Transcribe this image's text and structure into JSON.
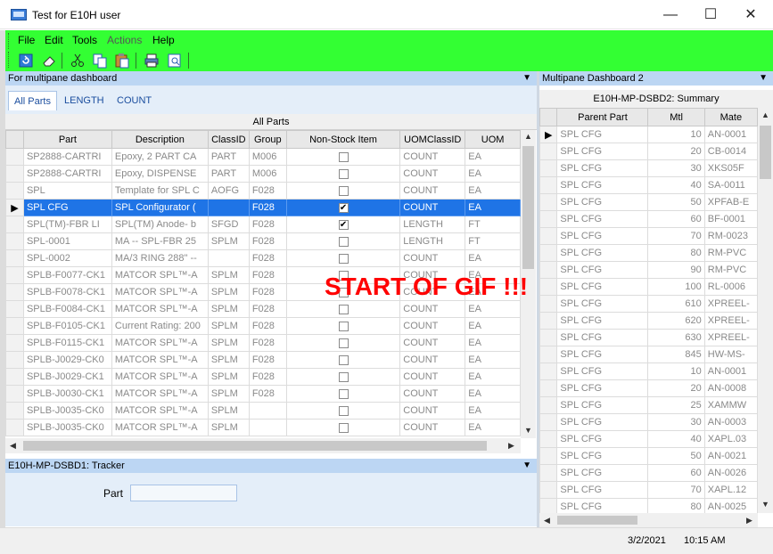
{
  "window": {
    "title": "Test for E10H user"
  },
  "menu": [
    "File",
    "Edit",
    "Tools",
    "Actions",
    "Help"
  ],
  "toolbar_icons": [
    "refresh-icon",
    "eraser-icon",
    "cut-icon",
    "copy-icon",
    "paste-icon",
    "print-icon",
    "print-preview-icon"
  ],
  "left_pane": {
    "header": "For multipane dashboard",
    "tabs": [
      "All Parts",
      "LENGTH",
      "COUNT"
    ],
    "grid_title": "All Parts",
    "columns": [
      "Part",
      "Description",
      "ClassID",
      "Group",
      "Non-Stock Item",
      "UOMClassID",
      "UOM"
    ],
    "rows": [
      {
        "part": "SP2888-CARTRI",
        "desc": "Epoxy, 2 PART CA",
        "classid": "PART",
        "group": "M006",
        "nonstock": false,
        "uomclass": "COUNT",
        "uom": "EA"
      },
      {
        "part": "SP2888-CARTRI",
        "desc": "Epoxy, DISPENSE",
        "classid": "PART",
        "group": "M006",
        "nonstock": false,
        "uomclass": "COUNT",
        "uom": "EA"
      },
      {
        "part": "SPL",
        "desc": "Template for SPL C",
        "classid": "AOFG",
        "group": "F028",
        "nonstock": false,
        "uomclass": "COUNT",
        "uom": "EA"
      },
      {
        "part": "SPL CFG",
        "desc": "SPL Configurator (",
        "classid": "",
        "group": "F028",
        "nonstock": true,
        "uomclass": "COUNT",
        "uom": "EA",
        "selected": true
      },
      {
        "part": "SPL(TM)-FBR LI",
        "desc": "SPL(TM) Anode- b",
        "classid": "SFGD",
        "group": "F028",
        "nonstock": true,
        "uomclass": "LENGTH",
        "uom": "FT"
      },
      {
        "part": "SPL-0001",
        "desc": "MA  -- SPL-FBR 25",
        "classid": "SPLM",
        "group": "F028",
        "nonstock": false,
        "uomclass": "LENGTH",
        "uom": "FT"
      },
      {
        "part": "SPL-0002",
        "desc": "MA/3 RING 288\" --",
        "classid": "",
        "group": "F028",
        "nonstock": false,
        "uomclass": "COUNT",
        "uom": "EA"
      },
      {
        "part": "SPLB-F0077-CK1",
        "desc": "MATCOR SPL™-A",
        "classid": "SPLM",
        "group": "F028",
        "nonstock": false,
        "uomclass": "COUNT",
        "uom": "EA"
      },
      {
        "part": "SPLB-F0078-CK1",
        "desc": "MATCOR SPL™-A",
        "classid": "SPLM",
        "group": "F028",
        "nonstock": false,
        "uomclass": "COUNT",
        "uom": "EA"
      },
      {
        "part": "SPLB-F0084-CK1",
        "desc": "MATCOR SPL™-A",
        "classid": "SPLM",
        "group": "F028",
        "nonstock": false,
        "uomclass": "COUNT",
        "uom": "EA"
      },
      {
        "part": "SPLB-F0105-CK1",
        "desc": "Current Rating: 200",
        "classid": "SPLM",
        "group": "F028",
        "nonstock": false,
        "uomclass": "COUNT",
        "uom": "EA"
      },
      {
        "part": "SPLB-F0115-CK1",
        "desc": "MATCOR SPL™-A",
        "classid": "SPLM",
        "group": "F028",
        "nonstock": false,
        "uomclass": "COUNT",
        "uom": "EA"
      },
      {
        "part": "SPLB-J0029-CK0",
        "desc": "MATCOR SPL™-A",
        "classid": "SPLM",
        "group": "F028",
        "nonstock": false,
        "uomclass": "COUNT",
        "uom": "EA"
      },
      {
        "part": "SPLB-J0029-CK1",
        "desc": "MATCOR SPL™-A",
        "classid": "SPLM",
        "group": "F028",
        "nonstock": false,
        "uomclass": "COUNT",
        "uom": "EA"
      },
      {
        "part": "SPLB-J0030-CK1",
        "desc": "MATCOR SPL™-A",
        "classid": "SPLM",
        "group": "F028",
        "nonstock": false,
        "uomclass": "COUNT",
        "uom": "EA"
      },
      {
        "part": "SPLB-J0035-CK0",
        "desc": "MATCOR SPL™-A",
        "classid": "SPLM",
        "group": "",
        "nonstock": false,
        "uomclass": "COUNT",
        "uom": "EA"
      },
      {
        "part": "SPLB-J0035-CK0",
        "desc": "MATCOR SPL™-A",
        "classid": "SPLM",
        "group": "",
        "nonstock": false,
        "uomclass": "COUNT",
        "uom": "EA"
      }
    ]
  },
  "overlay_text": "START OF GIF !!!",
  "tracker": {
    "header": "E10H-MP-DSBD1: Tracker",
    "part_label": "Part",
    "part_value": ""
  },
  "right_pane": {
    "header": "Multipane Dashboard 2",
    "subheader": "E10H-MP-DSBD2:  Summary",
    "columns": [
      "Parent Part",
      "Mtl",
      "Mate"
    ],
    "rows": [
      {
        "parent": "SPL CFG",
        "mtl": "10",
        "mate": "AN-0001"
      },
      {
        "parent": "SPL CFG",
        "mtl": "20",
        "mate": "CB-0014"
      },
      {
        "parent": "SPL CFG",
        "mtl": "30",
        "mate": "XKS05F"
      },
      {
        "parent": "SPL CFG",
        "mtl": "40",
        "mate": "SA-0011"
      },
      {
        "parent": "SPL CFG",
        "mtl": "50",
        "mate": "XPFAB-E"
      },
      {
        "parent": "SPL CFG",
        "mtl": "60",
        "mate": "BF-0001"
      },
      {
        "parent": "SPL CFG",
        "mtl": "70",
        "mate": "RM-0023"
      },
      {
        "parent": "SPL CFG",
        "mtl": "80",
        "mate": "RM-PVC"
      },
      {
        "parent": "SPL CFG",
        "mtl": "90",
        "mate": "RM-PVC"
      },
      {
        "parent": "SPL CFG",
        "mtl": "100",
        "mate": "RL-0006"
      },
      {
        "parent": "SPL CFG",
        "mtl": "610",
        "mate": "XPREEL-"
      },
      {
        "parent": "SPL CFG",
        "mtl": "620",
        "mate": "XPREEL-"
      },
      {
        "parent": "SPL CFG",
        "mtl": "630",
        "mate": "XPREEL-"
      },
      {
        "parent": "SPL CFG",
        "mtl": "845",
        "mate": "HW-MS-"
      },
      {
        "parent": "SPL CFG",
        "mtl": "10",
        "mate": "AN-0001"
      },
      {
        "parent": "SPL CFG",
        "mtl": "20",
        "mate": "AN-0008"
      },
      {
        "parent": "SPL CFG",
        "mtl": "25",
        "mate": "XAMMW"
      },
      {
        "parent": "SPL CFG",
        "mtl": "30",
        "mate": "AN-0003"
      },
      {
        "parent": "SPL CFG",
        "mtl": "40",
        "mate": "XAPL.03"
      },
      {
        "parent": "SPL CFG",
        "mtl": "50",
        "mate": "AN-0021"
      },
      {
        "parent": "SPL CFG",
        "mtl": "60",
        "mate": "AN-0026"
      },
      {
        "parent": "SPL CFG",
        "mtl": "70",
        "mate": "XAPL.12"
      },
      {
        "parent": "SPL CFG",
        "mtl": "80",
        "mate": "AN-0025"
      }
    ]
  },
  "status": {
    "date": "3/2/2021",
    "time": "10:15 AM"
  },
  "colors": {
    "toolbar": "#33ff33",
    "selection": "#1f74e6",
    "overlay": "#ff0000",
    "pane_header": "#bcd6f3"
  }
}
